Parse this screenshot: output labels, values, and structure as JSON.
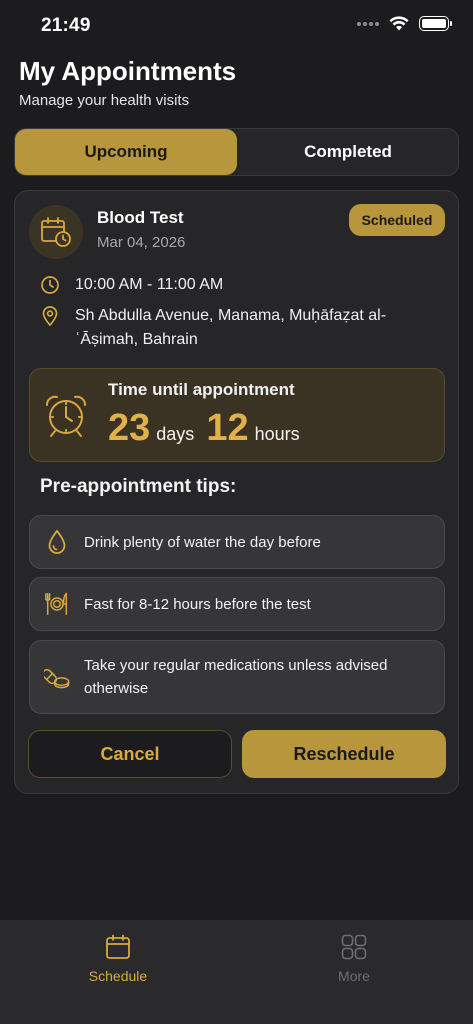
{
  "status_bar": {
    "time": "21:49"
  },
  "header": {
    "title": "My Appointments",
    "subtitle": "Manage your health visits"
  },
  "tabs": [
    {
      "label": "Upcoming",
      "active": true
    },
    {
      "label": "Completed",
      "active": false
    }
  ],
  "appointment": {
    "title": "Blood Test",
    "date": "Mar 04, 2026",
    "status": "Scheduled",
    "time_range": "10:00 AM - 11:00 AM",
    "location": "Sh Abdulla Avenue, Manama, Muḥāfaẓat al-ʿĀṣimah, Bahrain",
    "countdown": {
      "label": "Time until appointment",
      "days": "23",
      "days_unit": "days",
      "hours": "12",
      "hours_unit": "hours"
    },
    "tips_heading": "Pre-appointment tips:",
    "tips": [
      {
        "icon": "water-drop-icon",
        "text": "Drink plenty of water the day before"
      },
      {
        "icon": "utensils-icon",
        "text": "Fast for 8-12 hours before the test"
      },
      {
        "icon": "pills-icon",
        "text": "Take your regular medications unless advised otherwise"
      }
    ],
    "actions": {
      "cancel": "Cancel",
      "reschedule": "Reschedule"
    }
  },
  "bottom_nav": [
    {
      "label": "Schedule",
      "icon": "calendar-icon",
      "active": true
    },
    {
      "label": "More",
      "icon": "grid-icon",
      "active": false
    }
  ],
  "colors": {
    "accent": "#b8963c",
    "accent_text": "#e0b04a",
    "background": "#1c1c1e",
    "card": "#262628"
  }
}
